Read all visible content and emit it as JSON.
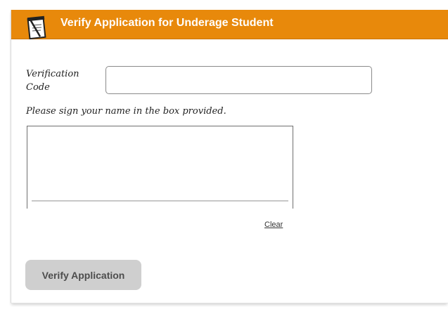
{
  "header": {
    "title": "Verify Application for Underage Student",
    "icon": "notepad-icon",
    "background_color": "#e8890b"
  },
  "form": {
    "verification_code_label": "Verification Code",
    "verification_code_value": "",
    "signature_instructions": "Please sign your name in the box provided.",
    "clear_label": "Clear",
    "submit_label": "Verify Application"
  }
}
